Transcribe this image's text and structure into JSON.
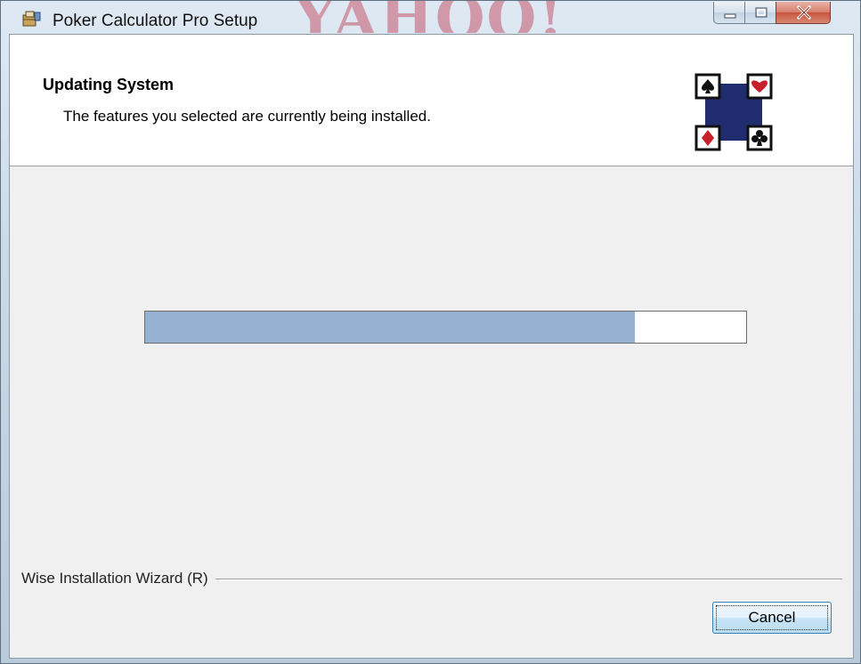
{
  "window": {
    "title": "Poker Calculator Pro Setup",
    "background_watermark": "YAHOO!",
    "icon": "installer-box-icon",
    "controls": [
      "minimize-icon",
      "maximize-icon",
      "close-icon"
    ]
  },
  "header": {
    "title": "Updating System",
    "description": "The features you selected are currently being installed.",
    "logo_icon": "card-suits-logo-icon"
  },
  "progress": {
    "percent": 81.5,
    "fill_color": "#97b1d2"
  },
  "footer": {
    "brand_label": "Wise Installation Wizard (R)",
    "cancel_label": "Cancel"
  }
}
